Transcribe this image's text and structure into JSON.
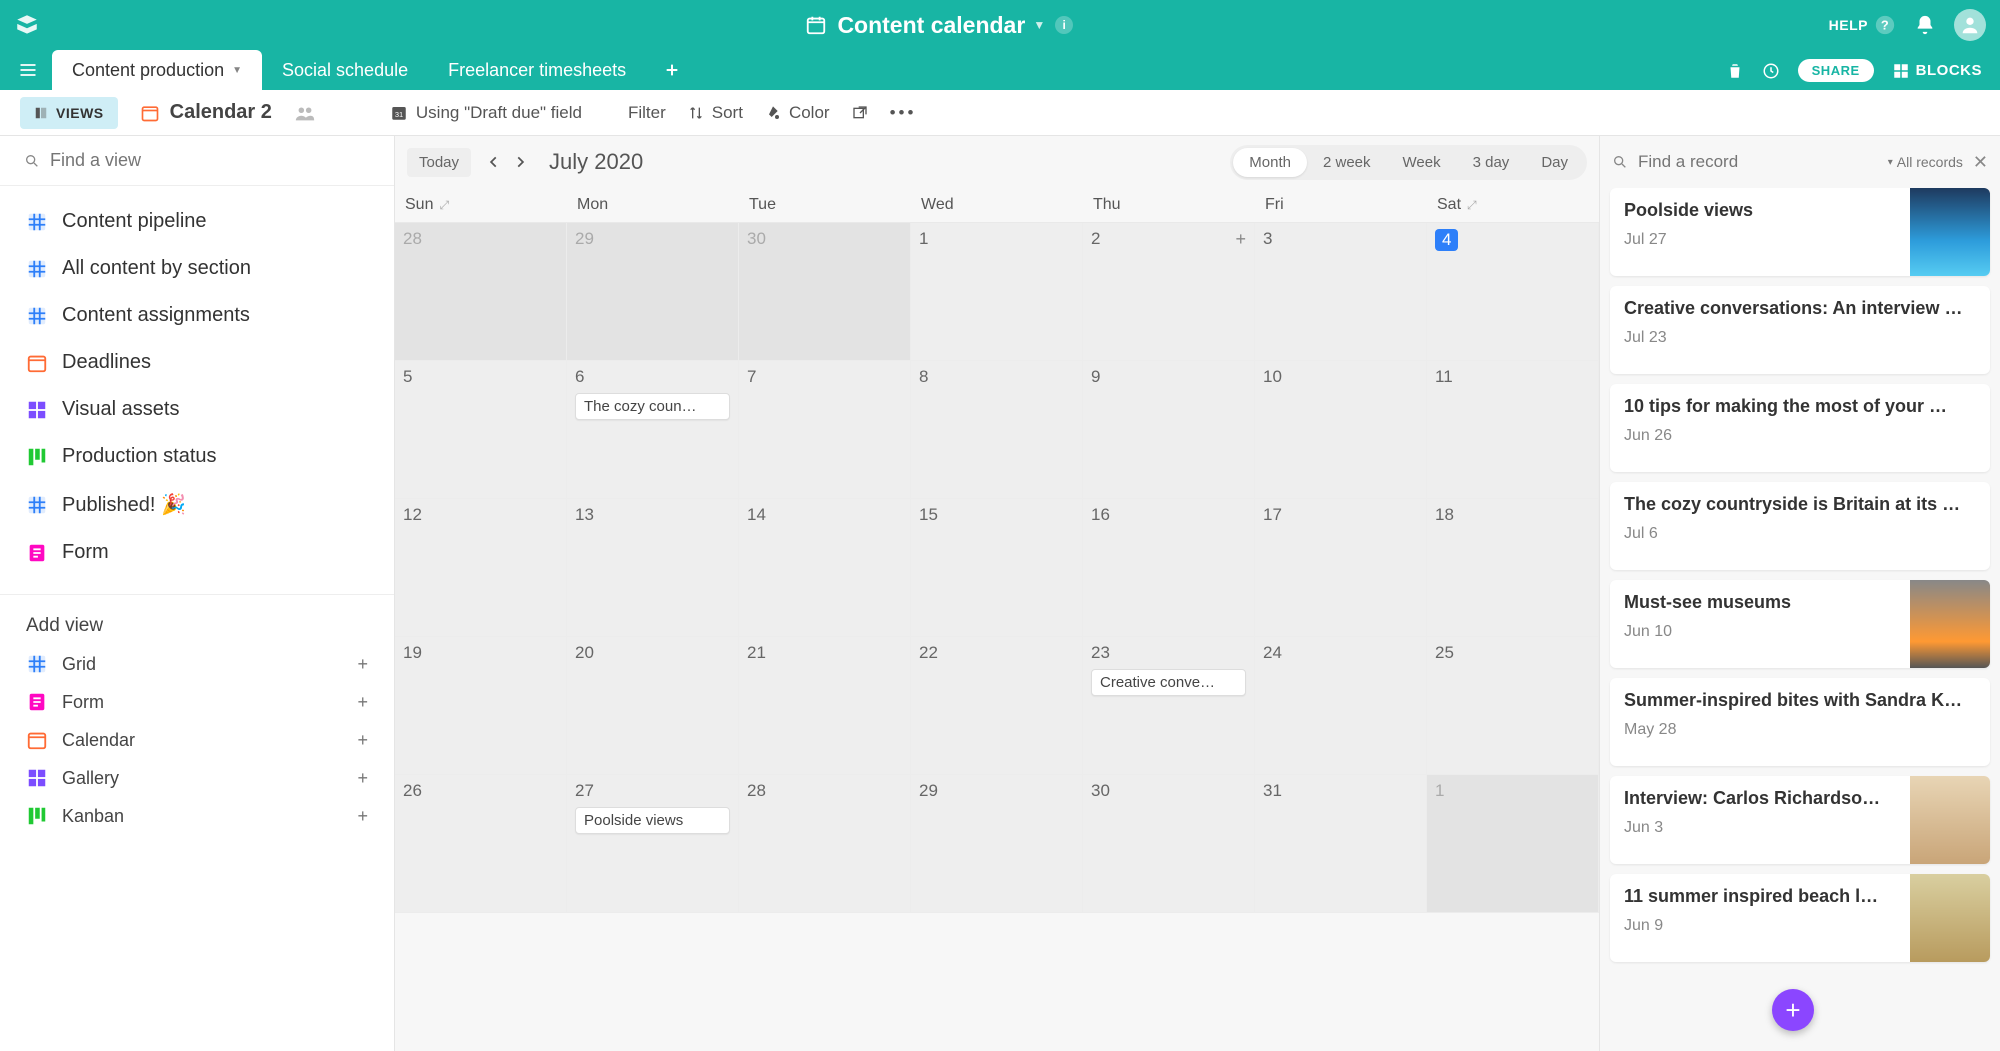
{
  "topbar": {
    "base_title": "Content calendar",
    "help_label": "HELP",
    "share_label": "SHARE",
    "blocks_label": "BLOCKS"
  },
  "tabs": [
    {
      "label": "Content production",
      "active": true
    },
    {
      "label": "Social schedule",
      "active": false
    },
    {
      "label": "Freelancer timesheets",
      "active": false
    }
  ],
  "toolbar": {
    "views_chip": "VIEWS",
    "view_name": "Calendar 2",
    "using_field": "Using \"Draft due\" field",
    "filter": "Filter",
    "sort": "Sort",
    "color": "Color"
  },
  "sidebar": {
    "search_placeholder": "Find a view",
    "views": [
      {
        "label": "Content pipeline",
        "icon": "grid",
        "color": "ic-blue"
      },
      {
        "label": "All content by section",
        "icon": "grid",
        "color": "ic-blue"
      },
      {
        "label": "Content assignments",
        "icon": "grid",
        "color": "ic-blue"
      },
      {
        "label": "Deadlines",
        "icon": "calendar",
        "color": "ic-orange"
      },
      {
        "label": "Visual assets",
        "icon": "gallery",
        "color": "ic-purple"
      },
      {
        "label": "Production status",
        "icon": "kanban",
        "color": "ic-green"
      },
      {
        "label": "Published! 🎉",
        "icon": "grid",
        "color": "ic-blue"
      },
      {
        "label": "Form",
        "icon": "form",
        "color": "ic-pink"
      }
    ],
    "addview_title": "Add view",
    "addview_types": [
      {
        "label": "Grid",
        "icon": "grid",
        "color": "ic-blue"
      },
      {
        "label": "Form",
        "icon": "form",
        "color": "ic-pink"
      },
      {
        "label": "Calendar",
        "icon": "calendar",
        "color": "ic-orange"
      },
      {
        "label": "Gallery",
        "icon": "gallery",
        "color": "ic-purple"
      },
      {
        "label": "Kanban",
        "icon": "kanban",
        "color": "ic-green"
      }
    ]
  },
  "calendar": {
    "today_btn": "Today",
    "month_label": "July 2020",
    "scopes": [
      "Month",
      "2 week",
      "Week",
      "3 day",
      "Day"
    ],
    "active_scope": 0,
    "day_headers": [
      "Sun",
      "Mon",
      "Tue",
      "Wed",
      "Thu",
      "Fri",
      "Sat"
    ],
    "weeks": [
      [
        {
          "n": "28",
          "in": false
        },
        {
          "n": "29",
          "in": false
        },
        {
          "n": "30",
          "in": false
        },
        {
          "n": "1",
          "in": true
        },
        {
          "n": "2",
          "in": true,
          "showplus": true
        },
        {
          "n": "3",
          "in": true
        },
        {
          "n": "4",
          "in": true,
          "today": true
        }
      ],
      [
        {
          "n": "5",
          "in": true
        },
        {
          "n": "6",
          "in": true,
          "events": [
            "The cozy coun…"
          ]
        },
        {
          "n": "7",
          "in": true
        },
        {
          "n": "8",
          "in": true
        },
        {
          "n": "9",
          "in": true
        },
        {
          "n": "10",
          "in": true
        },
        {
          "n": "11",
          "in": true
        }
      ],
      [
        {
          "n": "12",
          "in": true
        },
        {
          "n": "13",
          "in": true
        },
        {
          "n": "14",
          "in": true
        },
        {
          "n": "15",
          "in": true
        },
        {
          "n": "16",
          "in": true
        },
        {
          "n": "17",
          "in": true
        },
        {
          "n": "18",
          "in": true
        }
      ],
      [
        {
          "n": "19",
          "in": true
        },
        {
          "n": "20",
          "in": true
        },
        {
          "n": "21",
          "in": true
        },
        {
          "n": "22",
          "in": true
        },
        {
          "n": "23",
          "in": true,
          "events": [
            "Creative conve…"
          ]
        },
        {
          "n": "24",
          "in": true
        },
        {
          "n": "25",
          "in": true
        }
      ],
      [
        {
          "n": "26",
          "in": true
        },
        {
          "n": "27",
          "in": true,
          "events": [
            "Poolside views"
          ]
        },
        {
          "n": "28",
          "in": true
        },
        {
          "n": "29",
          "in": true
        },
        {
          "n": "30",
          "in": true
        },
        {
          "n": "31",
          "in": true
        },
        {
          "n": "1",
          "in": false
        }
      ]
    ]
  },
  "records": {
    "search_placeholder": "Find a record",
    "all_records_label": "All records",
    "items": [
      {
        "title": "Poolside views",
        "date": "Jul 27",
        "thumb": "t-pool"
      },
      {
        "title": "Creative conversations: An interview …",
        "date": "Jul 23"
      },
      {
        "title": "10 tips for making the most of your …",
        "date": "Jun 26"
      },
      {
        "title": "The cozy countryside is Britain at its …",
        "date": "Jul 6"
      },
      {
        "title": "Must-see museums",
        "date": "Jun 10",
        "thumb": "t-museum"
      },
      {
        "title": "Summer-inspired bites with Sandra K…",
        "date": "May 28"
      },
      {
        "title": "Interview: Carlos Richardso…",
        "date": "Jun 3",
        "thumb": "t-desert"
      },
      {
        "title": "11 summer inspired beach l…",
        "date": "Jun 9",
        "thumb": "t-beach"
      }
    ]
  }
}
